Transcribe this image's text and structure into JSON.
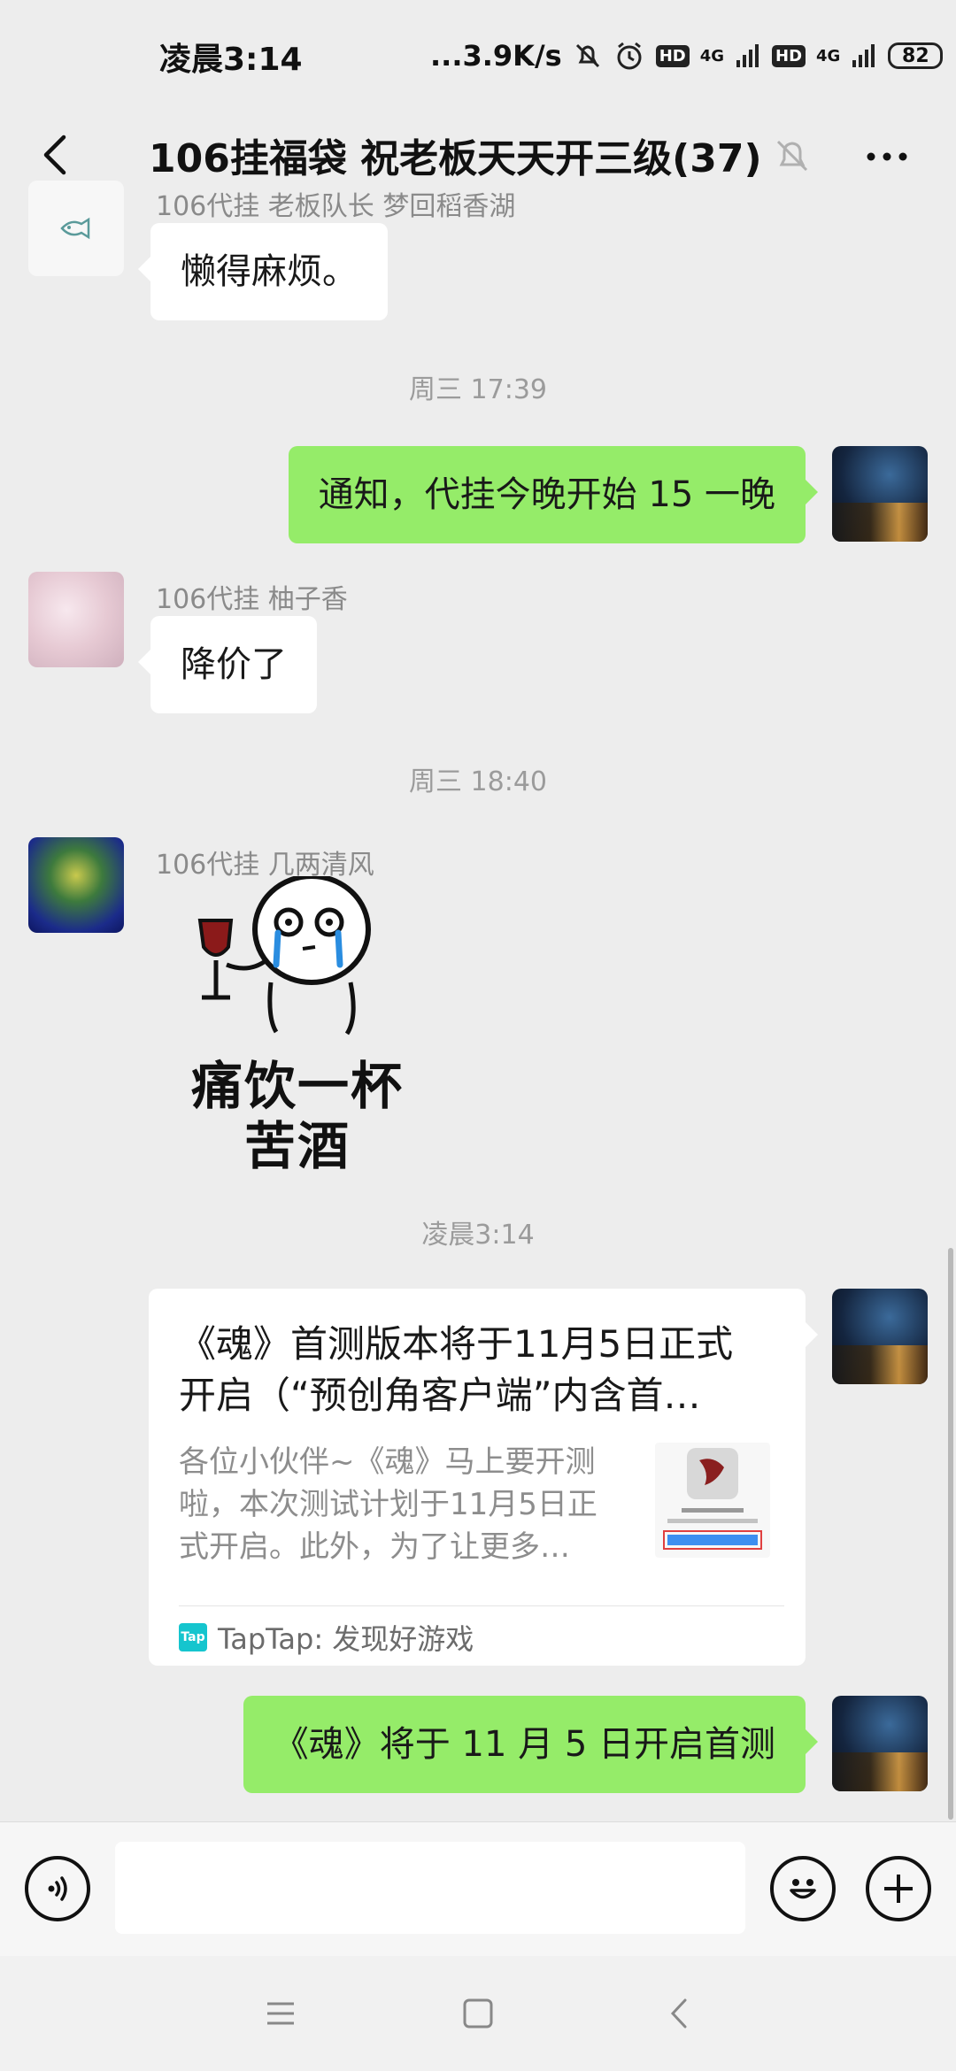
{
  "status_bar": {
    "time": "凌晨3:14",
    "network_speed": "...3.9K/s",
    "hd1": "HD",
    "sig1": "4G",
    "hd2": "HD",
    "sig2": "4G",
    "battery": "82",
    "icons": [
      "muted-bell-icon",
      "alarm-icon",
      "signal-icon",
      "battery-icon"
    ]
  },
  "header": {
    "title": "106挂福袋 祝老板天天开三级(37)",
    "icons": [
      "back-icon",
      "mute-bell-icon",
      "more-icon"
    ]
  },
  "messages": {
    "m1_sender": "106代挂 老板队长 梦回稻香湖",
    "m1_text": "懒得麻烦。",
    "ts1": "周三 17:39",
    "m2_text": "通知，代挂今晚开始 15 一晚",
    "m3_sender": "106代挂 柚子香",
    "m3_text": "降价了",
    "ts2": "周三 18:40",
    "m4_sender": "106代挂  几两清风",
    "m4_sticker_line1": "痛饮一杯",
    "m4_sticker_line2": "苦酒",
    "ts3": "凌晨3:14",
    "card": {
      "title": "《魂》首测版本将于11月5日正式开启（“预创角客户端”内含首…",
      "description": "各位小伙伴~《魂》马上要开测啦，本次测试计划于11月5日正式开启。此外，为了让更多…",
      "source_icon_text": "Tap",
      "source": "TapTap: 发现好游戏"
    },
    "m6_text": "《魂》将于 11 月 5 日开启首测"
  },
  "input_bar": {
    "placeholder": "",
    "icons": [
      "voice-icon",
      "emoji-icon",
      "plus-icon"
    ]
  },
  "nav_bar": {
    "icons": [
      "menu-icon",
      "home-icon",
      "back-nav-icon"
    ]
  }
}
